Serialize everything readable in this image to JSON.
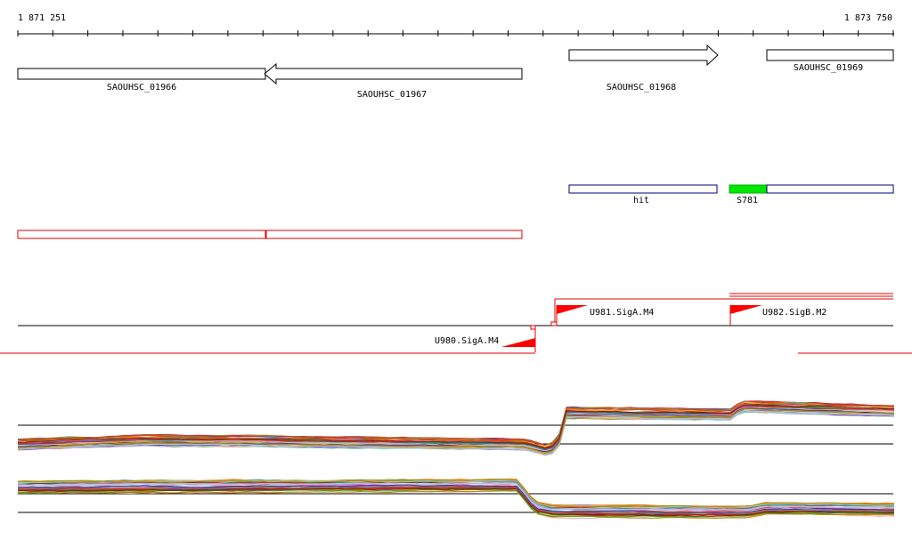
{
  "ruler": {
    "start_label": "1 871 251",
    "end_label": "1 873 750"
  },
  "genes": [
    {
      "name": "SAOUHSC_01966"
    },
    {
      "name": "SAOUHSC_01967"
    },
    {
      "name": "SAOUHSC_01968"
    },
    {
      "name": "SAOUHSC_01969"
    }
  ],
  "features": [
    {
      "name": "hit"
    },
    {
      "name": "S781"
    }
  ],
  "promoters": [
    {
      "name": "U980.SigA.M4"
    },
    {
      "name": "U981.SigA.M4"
    },
    {
      "name": "U982.SigB.M2"
    }
  ],
  "colors": {
    "axis": "#000000",
    "gene_outline": "#000000",
    "feature_outline": "#00007f",
    "feature_fill_green": "#00e600",
    "operon_outline": "#e00000",
    "promoter_red": "#ff0000",
    "transcript_red": "#e00000"
  },
  "expression_palette": [
    "#cc3333",
    "#33a02c",
    "#1f78b4",
    "#ff7f00",
    "#6a3d9a",
    "#b15928",
    "#e31a1c",
    "#999933",
    "#888888",
    "#a6cee3",
    "#fb9a99",
    "#cab2d6",
    "#8dd3c7",
    "#663300",
    "#333399",
    "#bb8800",
    "#ff66cc",
    "#339999"
  ]
}
